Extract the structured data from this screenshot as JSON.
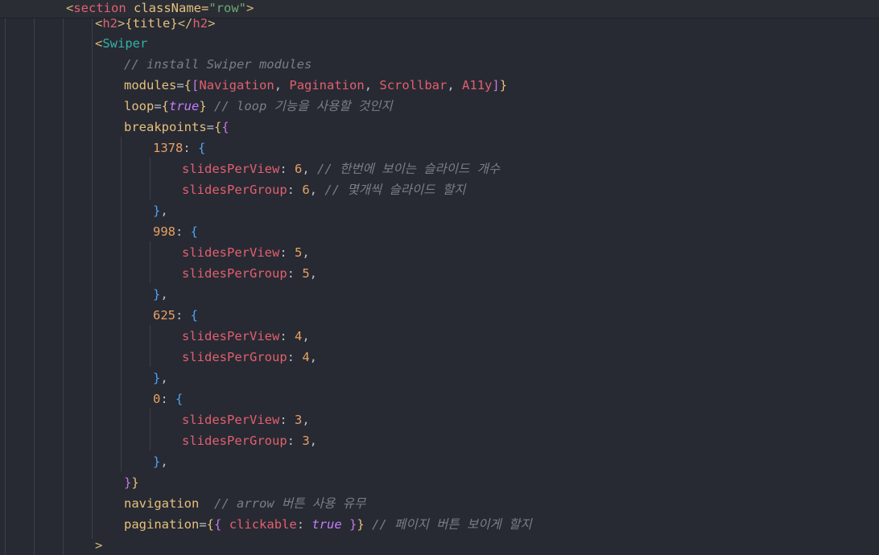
{
  "sticky": {
    "open": "<",
    "tag": "section",
    "attr": " className=",
    "value": "\"row\"",
    "close": ">"
  },
  "l1": {
    "open": "<",
    "tag": "h2",
    "mid": ">",
    "brace_open": "{",
    "expr": "title",
    "brace_close": "}",
    "close_open": "</",
    "close_tag": "h2",
    "close": ">"
  },
  "l2": {
    "open": "<",
    "tag": "Swiper"
  },
  "l3": {
    "comment": "// install Swiper modules"
  },
  "l4": {
    "attr": "modules",
    "eq": "=",
    "b1": "{",
    "b2": "[",
    "items": [
      "Navigation",
      "Pagination",
      "Scrollbar",
      "A11y"
    ],
    "sep": ", ",
    "b2c": "]",
    "b1c": "}"
  },
  "l5": {
    "attr": "loop",
    "eq": "=",
    "b1": "{",
    "val": "true",
    "b1c": "}",
    "comment": " // loop 기능을 사용할 것인지"
  },
  "l6": {
    "attr": "breakpoints",
    "eq": "=",
    "b1": "{",
    "b2": "{"
  },
  "bp1": {
    "key": "1378",
    "colon": ": ",
    "open": "{",
    "r1": {
      "prop": "slidesPerView",
      "colon": ": ",
      "num": "6",
      "comma": ",",
      "comment": " // 한번에 보이는 슬라이드 개수"
    },
    "r2": {
      "prop": "slidesPerGroup",
      "colon": ": ",
      "num": "6",
      "comma": ",",
      "comment": " // 몇개씩 슬라이드 할지"
    },
    "close": "}",
    "comma": ","
  },
  "bp2": {
    "key": "998",
    "colon": ": ",
    "open": "{",
    "r1": {
      "prop": "slidesPerView",
      "colon": ": ",
      "num": "5",
      "comma": ","
    },
    "r2": {
      "prop": "slidesPerGroup",
      "colon": ": ",
      "num": "5",
      "comma": ","
    },
    "close": "}",
    "comma": ","
  },
  "bp3": {
    "key": "625",
    "colon": ": ",
    "open": "{",
    "r1": {
      "prop": "slidesPerView",
      "colon": ": ",
      "num": "4",
      "comma": ","
    },
    "r2": {
      "prop": "slidesPerGroup",
      "colon": ": ",
      "num": "4",
      "comma": ","
    },
    "close": "}",
    "comma": ","
  },
  "bp4": {
    "key": "0",
    "colon": ": ",
    "open": "{",
    "r1": {
      "prop": "slidesPerView",
      "colon": ": ",
      "num": "3",
      "comma": ","
    },
    "r2": {
      "prop": "slidesPerGroup",
      "colon": ": ",
      "num": "3",
      "comma": ","
    },
    "close": "}",
    "comma": ","
  },
  "l23": {
    "b2c": "}",
    "b1c": "}"
  },
  "l24": {
    "attr": "navigation",
    "comment": "  // arrow 버튼 사용 유무"
  },
  "l25": {
    "attr": "pagination",
    "eq": "=",
    "b1": "{",
    "b2": "{",
    "sp": " ",
    "key": "clickable",
    "colon": ": ",
    "val": "true",
    "sp2": " ",
    "b2c": "}",
    "b1c": "}",
    "comment": " // 페이지 버튼 보이게 할지"
  },
  "l26": {
    "text": ">"
  },
  "colors": {
    "background": "#272a33",
    "tag": "#d5b778",
    "jsx_component": "#32b3a6",
    "string": "#6aab73",
    "property": "#e35f6e",
    "number": "#e7a163",
    "keyword": "#c77dff",
    "comment": "#7a7e85"
  }
}
